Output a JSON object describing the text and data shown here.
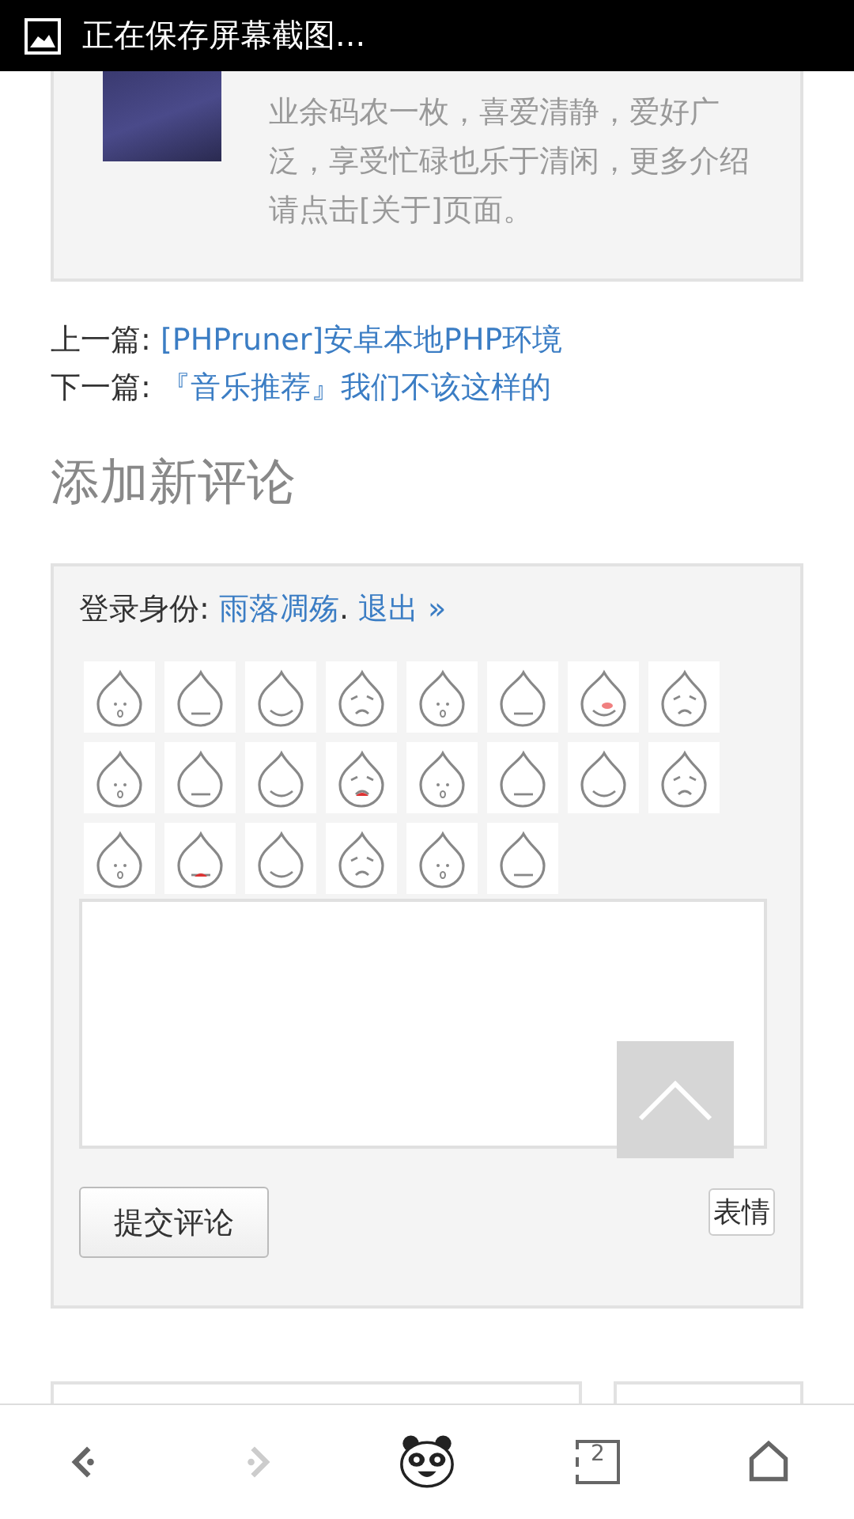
{
  "status_bar": {
    "notification": "正在保存屏幕截图..."
  },
  "author_card": {
    "bio": "业余码农一枚，喜爱清静，爱好广泛，享受忙碌也乐于清闲，更多介绍请点击[关于]页面。"
  },
  "post_nav": [
    {
      "label": "上一篇: ",
      "link": "[PHPruner]安卓本地PHP环境"
    },
    {
      "label": "下一篇: ",
      "link": "『音乐推荐』我们不该这样的"
    }
  ],
  "comment_form": {
    "heading": "添加新评论",
    "login_label": "登录身份: ",
    "user": "雨落凋殇",
    "separator": ".",
    "logout": "退出 »",
    "submit": "提交评论",
    "emoji_button": "表情"
  },
  "bottom_nav": [
    {
      "kind": "back",
      "disabled": false
    },
    {
      "kind": "forward",
      "disabled": true
    },
    {
      "kind": "panda"
    },
    {
      "kind": "tabs",
      "count": "2"
    },
    {
      "kind": "home"
    }
  ]
}
